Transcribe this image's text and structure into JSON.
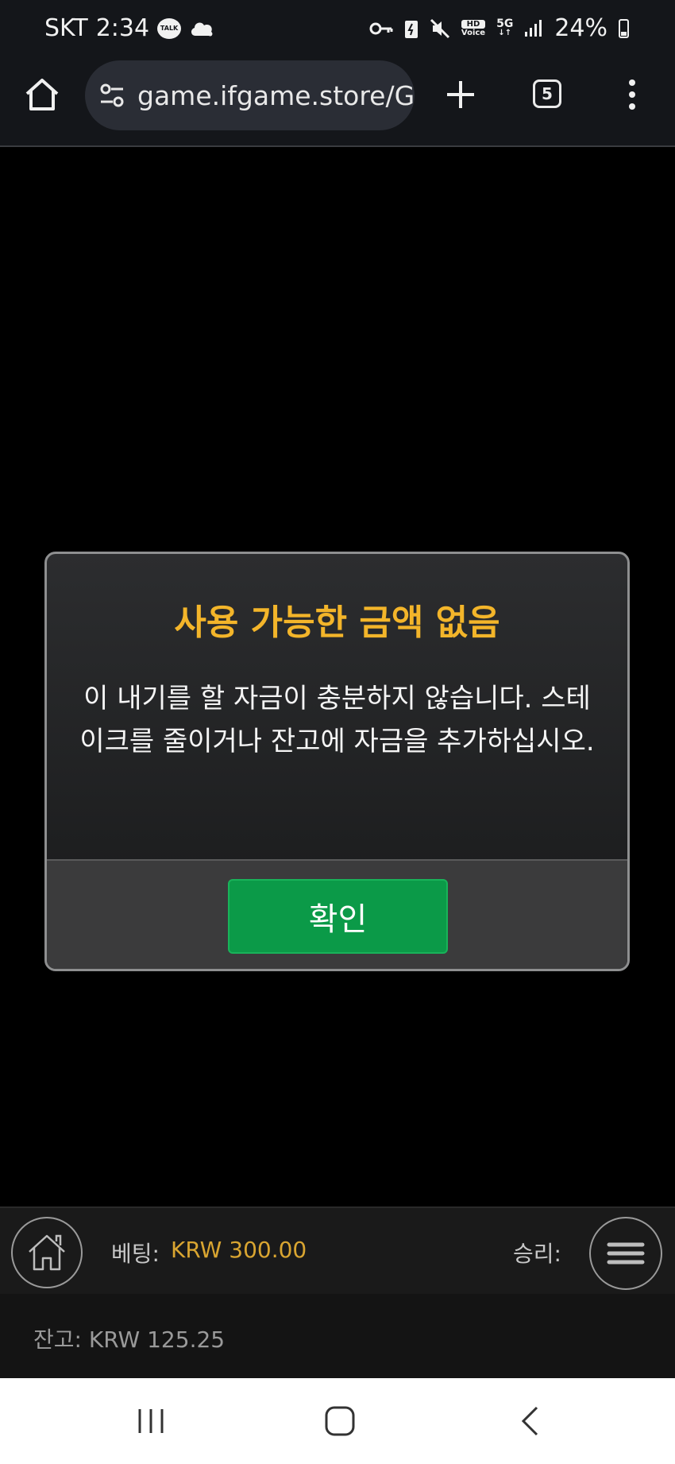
{
  "status_bar": {
    "carrier": "SKT",
    "time": "2:34",
    "talk_badge": "TALK",
    "hd_voice": "HD",
    "voice_label": "Voice",
    "network": "5G",
    "battery": "24%"
  },
  "browser": {
    "url": "game.ifgame.store/G",
    "tab_count": "5"
  },
  "dialog": {
    "title": "사용 가능한 금액 없음",
    "message": "이 내기를 할 자금이 충분하지 않습니다. 스테이크를 줄이거나 잔고에 자금을 추가하십시오.",
    "confirm_label": "확인",
    "title_color": "#f3b52a",
    "button_color": "#0b9a48"
  },
  "game_bar": {
    "bet_label": "베팅:",
    "bet_value": "KRW 300.00",
    "win_label": "승리:",
    "balance": "잔고: KRW 125.25"
  },
  "icons": {
    "browser_home": "home-icon",
    "site_settings": "tune-icon",
    "new_tab": "plus-icon",
    "tabs": "tabs-icon",
    "more": "more-vert-icon",
    "game_home": "home-outline-icon",
    "game_menu": "hamburger-icon",
    "nav_recents": "recents-icon",
    "nav_home": "nav-home-icon",
    "nav_back": "back-icon"
  }
}
